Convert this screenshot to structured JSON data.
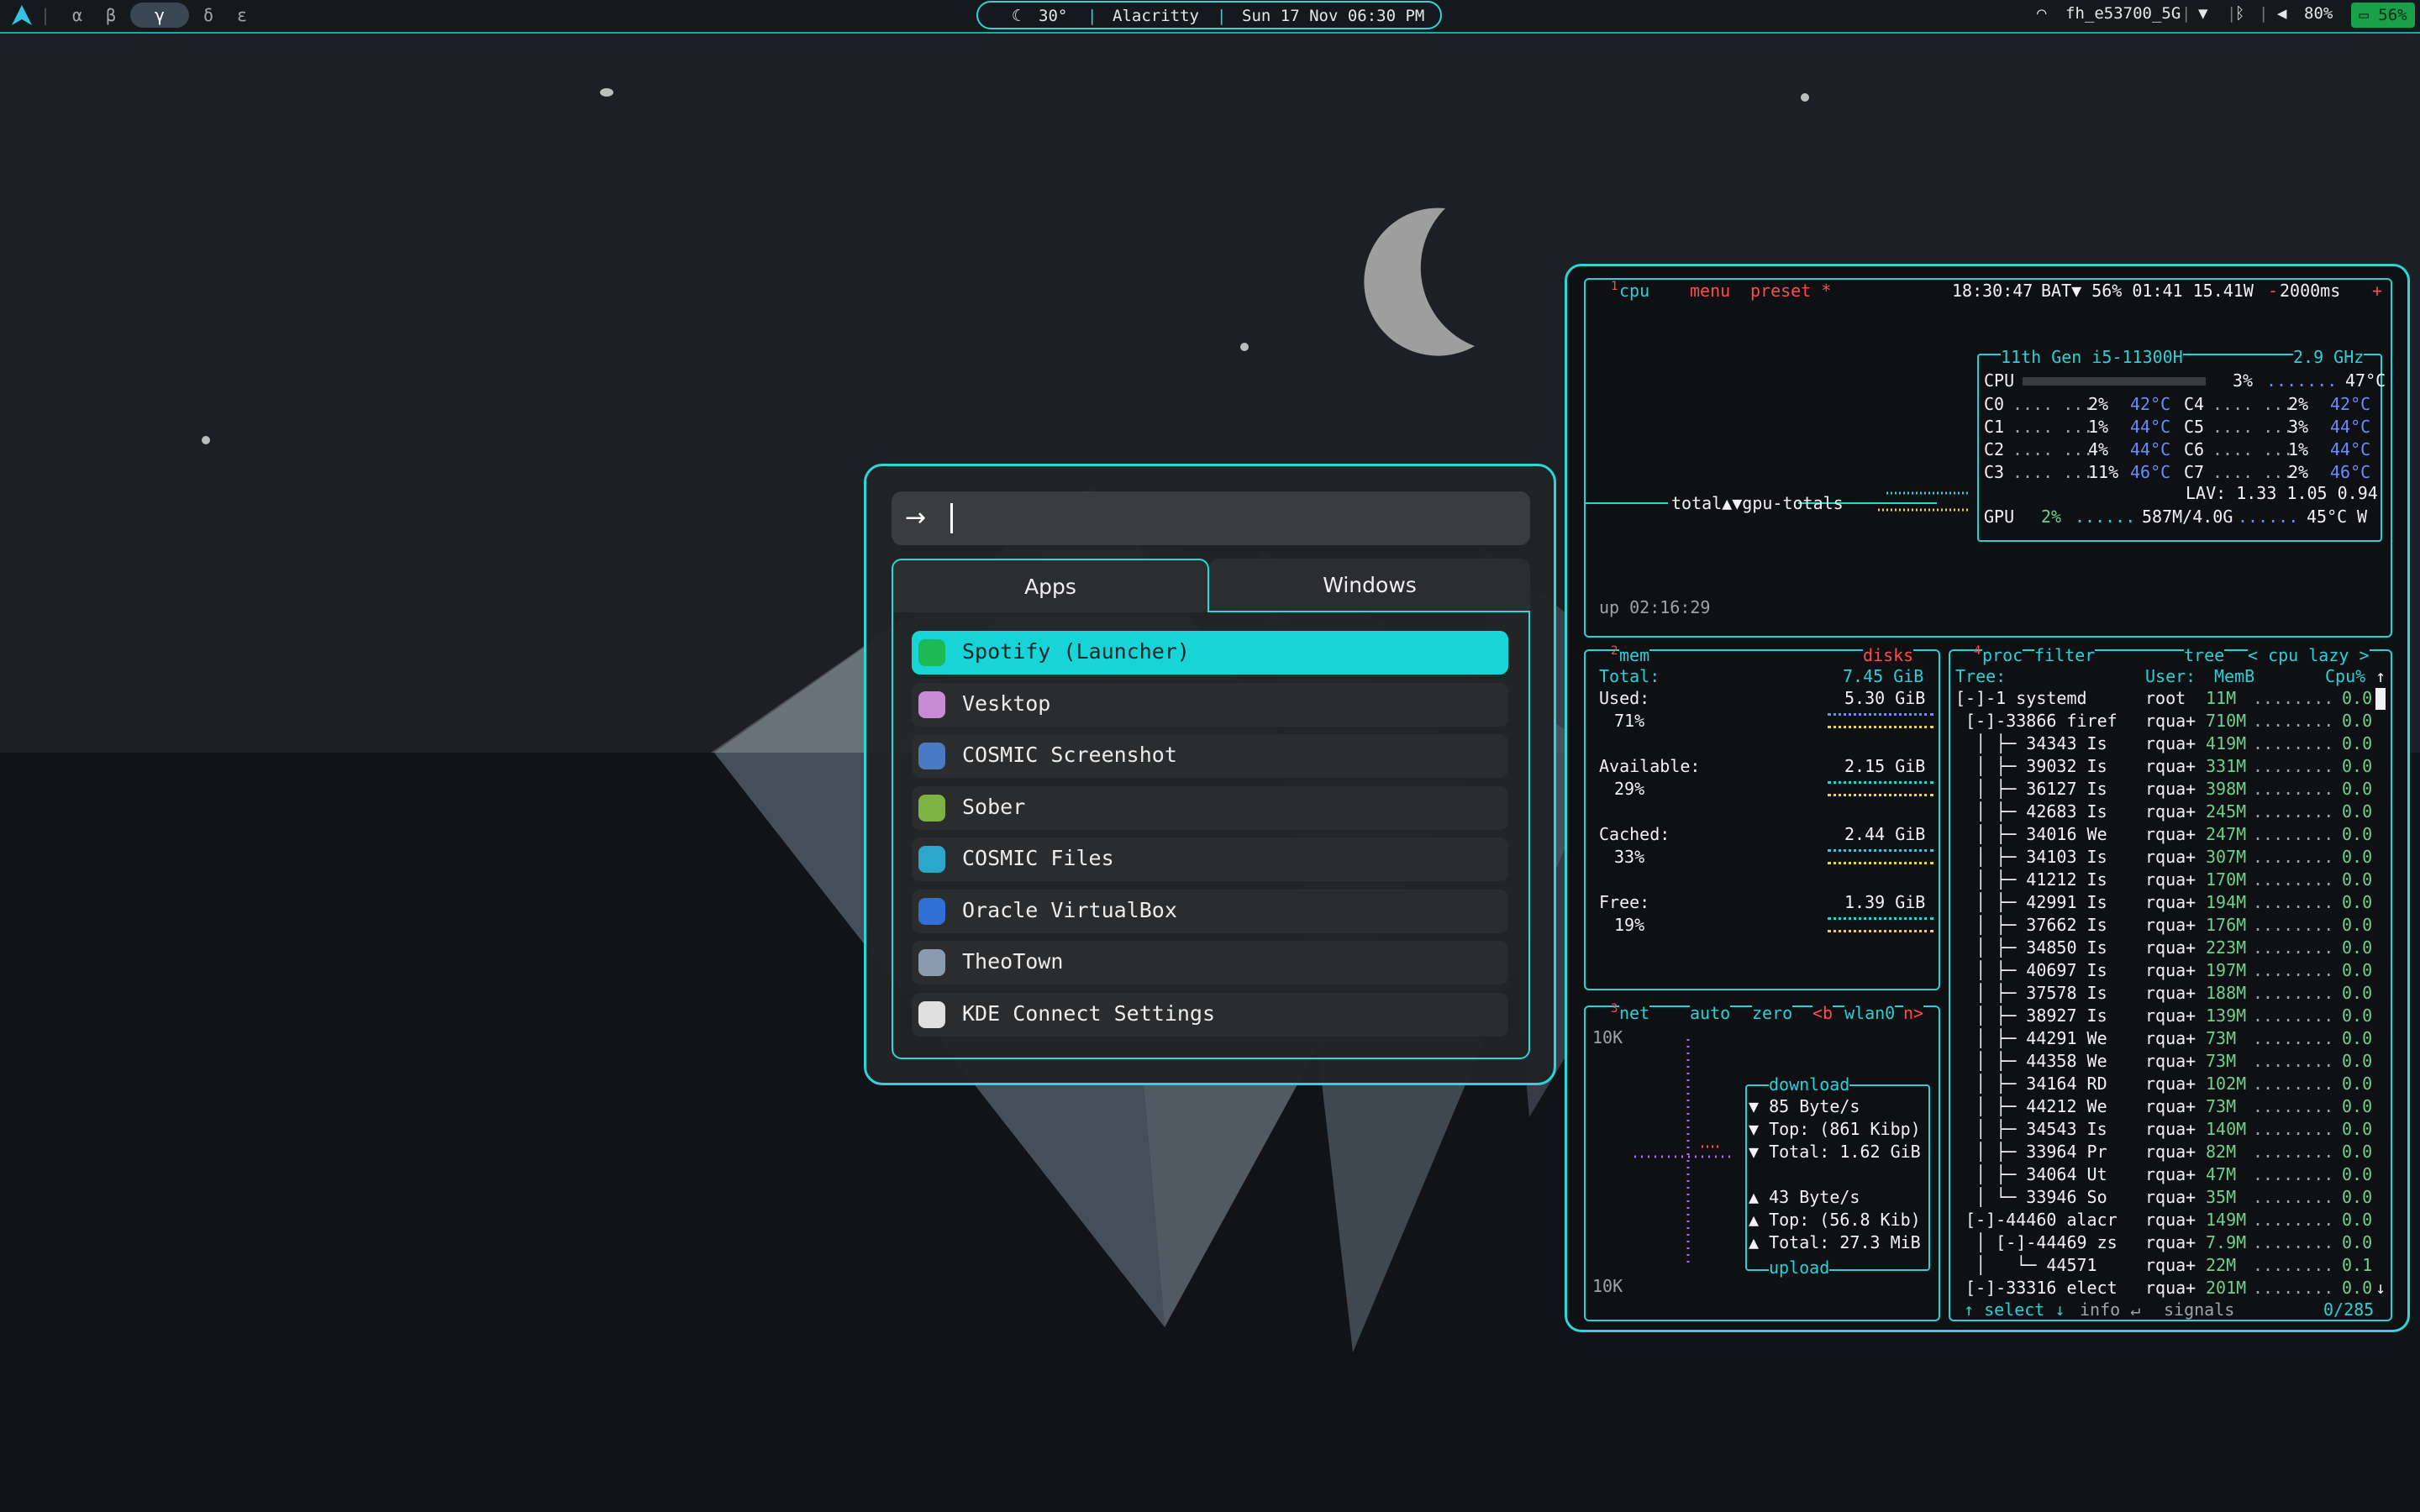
{
  "topbar": {
    "workspaces": [
      "α",
      "β",
      "γ",
      "δ",
      "ε"
    ],
    "active_workspace": "γ",
    "weather": "30°",
    "active_window": "Alacritty",
    "datetime": "Sun 17 Nov 06:30 PM",
    "wifi": "fh_e53700_5G",
    "volume": "80%",
    "battery": "56%"
  },
  "launcher": {
    "prompt_icon": "arrow-right-icon",
    "query": "",
    "tabs": [
      "Apps",
      "Windows"
    ],
    "active_tab": "Apps",
    "items": [
      {
        "label": "Spotify (Launcher)",
        "icon": "spotify-icon",
        "color": "#1db954",
        "selected": true
      },
      {
        "label": "Vesktop",
        "icon": "vesktop-icon",
        "color": "#c98ad6",
        "selected": false
      },
      {
        "label": "COSMIC Screenshot",
        "icon": "screenshot-icon",
        "color": "#4a78c2",
        "selected": false
      },
      {
        "label": "Sober",
        "icon": "sober-icon",
        "color": "#7cb342",
        "selected": false
      },
      {
        "label": "COSMIC Files",
        "icon": "folder-icon",
        "color": "#2aa7c9",
        "selected": false
      },
      {
        "label": "Oracle VirtualBox",
        "icon": "virtualbox-icon",
        "color": "#2f6fd6",
        "selected": false
      },
      {
        "label": "TheoTown",
        "icon": "theotown-icon",
        "color": "#8a9bb0",
        "selected": false
      },
      {
        "label": "KDE Connect Settings",
        "icon": "kdeconnect-icon",
        "color": "#e0e0e0",
        "selected": false
      }
    ]
  },
  "btop": {
    "cpu_header": {
      "num": "1",
      "title": "cpu",
      "menu": "menu",
      "preset": "preset *",
      "clock": "18:30:47",
      "bat": "BAT▼ 56% 01:41 15.41W",
      "interval": "2000ms"
    },
    "cpu_model": "11th Gen i5-11300H",
    "cpu_freq": "2.9 GHz",
    "cpu_total": {
      "label": "CPU",
      "pct": "3%",
      "temp": "47°C"
    },
    "cores": [
      {
        "name": "C0",
        "pct": "2%",
        "temp": "42°C"
      },
      {
        "name": "C1",
        "pct": "1%",
        "temp": "44°C"
      },
      {
        "name": "C2",
        "pct": "4%",
        "temp": "44°C"
      },
      {
        "name": "C3",
        "pct": "11%",
        "temp": "46°C"
      },
      {
        "name": "C4",
        "pct": "2%",
        "temp": "42°C"
      },
      {
        "name": "C5",
        "pct": "3%",
        "temp": "44°C"
      },
      {
        "name": "C6",
        "pct": "1%",
        "temp": "44°C"
      },
      {
        "name": "C7",
        "pct": "2%",
        "temp": "46°C"
      }
    ],
    "lav": "LAV: 1.33 1.05 0.94",
    "gpu": {
      "label": "GPU",
      "pct": "2%",
      "mem": "587M/4.0G",
      "temp": "45°C",
      "suffix": "W"
    },
    "graph_label": "total▲▼gpu-totals",
    "uptime": "up 02:16:29",
    "mem": {
      "num": "2",
      "title": "mem",
      "disks": "disks",
      "total_label": "Total:",
      "total": "7.45 GiB",
      "rows": [
        {
          "label": "Used:",
          "value": "5.30 GiB",
          "pct": "71%"
        },
        {
          "label": "Available:",
          "value": "2.15 GiB",
          "pct": "29%"
        },
        {
          "label": "Cached:",
          "value": "2.44 GiB",
          "pct": "33%"
        },
        {
          "label": "Free:",
          "value": "1.39 GiB",
          "pct": "19%"
        }
      ]
    },
    "net": {
      "num": "3",
      "title": "net",
      "auto": "auto",
      "zero": "zero",
      "b": "<b",
      "iface": "wlan0",
      "n": "n>",
      "scale_top": "10K",
      "scale_bottom": "10K",
      "download_title": "download",
      "download": [
        "▼ 85 Byte/s",
        "▼ Top: (861 Kibp)",
        "▼ Total: 1.62 GiB"
      ],
      "upload": [
        "▲ 43 Byte/s",
        "▲ Top: (56.8 Kib)",
        "▲ Total: 27.3 MiB"
      ],
      "upload_title": "upload"
    },
    "proc": {
      "num": "4",
      "title": "proc",
      "filter": "filter",
      "tree": "tree",
      "sort": "< cpu lazy >",
      "headers": {
        "tree": "Tree:",
        "user": "User:",
        "mem": "MemB",
        "cpu": "Cpu%"
      },
      "rows": [
        {
          "tree": "[-]-1 systemd",
          "user": "root",
          "mem": "11M",
          "cpu": "0.0"
        },
        {
          "tree": " [-]-33866 firef",
          "user": "rqua+",
          "mem": "710M",
          "cpu": "0.0"
        },
        {
          "tree": "  │ ├─ 34343 Is",
          "user": "rqua+",
          "mem": "419M",
          "cpu": "0.0"
        },
        {
          "tree": "  │ ├─ 39032 Is",
          "user": "rqua+",
          "mem": "331M",
          "cpu": "0.0"
        },
        {
          "tree": "  │ ├─ 36127 Is",
          "user": "rqua+",
          "mem": "398M",
          "cpu": "0.0"
        },
        {
          "tree": "  │ ├─ 42683 Is",
          "user": "rqua+",
          "mem": "245M",
          "cpu": "0.0"
        },
        {
          "tree": "  │ ├─ 34016 We",
          "user": "rqua+",
          "mem": "247M",
          "cpu": "0.0"
        },
        {
          "tree": "  │ ├─ 34103 Is",
          "user": "rqua+",
          "mem": "307M",
          "cpu": "0.0"
        },
        {
          "tree": "  │ ├─ 41212 Is",
          "user": "rqua+",
          "mem": "170M",
          "cpu": "0.0"
        },
        {
          "tree": "  │ ├─ 42991 Is",
          "user": "rqua+",
          "mem": "194M",
          "cpu": "0.0"
        },
        {
          "tree": "  │ ├─ 37662 Is",
          "user": "rqua+",
          "mem": "176M",
          "cpu": "0.0"
        },
        {
          "tree": "  │ ├─ 34850 Is",
          "user": "rqua+",
          "mem": "223M",
          "cpu": "0.0"
        },
        {
          "tree": "  │ ├─ 40697 Is",
          "user": "rqua+",
          "mem": "197M",
          "cpu": "0.0"
        },
        {
          "tree": "  │ ├─ 37578 Is",
          "user": "rqua+",
          "mem": "188M",
          "cpu": "0.0"
        },
        {
          "tree": "  │ ├─ 38927 Is",
          "user": "rqua+",
          "mem": "139M",
          "cpu": "0.0"
        },
        {
          "tree": "  │ ├─ 44291 We",
          "user": "rqua+",
          "mem": "73M",
          "cpu": "0.0"
        },
        {
          "tree": "  │ ├─ 44358 We",
          "user": "rqua+",
          "mem": "73M",
          "cpu": "0.0"
        },
        {
          "tree": "  │ ├─ 34164 RD",
          "user": "rqua+",
          "mem": "102M",
          "cpu": "0.0"
        },
        {
          "tree": "  │ ├─ 44212 We",
          "user": "rqua+",
          "mem": "73M",
          "cpu": "0.0"
        },
        {
          "tree": "  │ ├─ 34543 Is",
          "user": "rqua+",
          "mem": "140M",
          "cpu": "0.0"
        },
        {
          "tree": "  │ ├─ 33964 Pr",
          "user": "rqua+",
          "mem": "82M",
          "cpu": "0.0"
        },
        {
          "tree": "  │ ├─ 34064 Ut",
          "user": "rqua+",
          "mem": "47M",
          "cpu": "0.0"
        },
        {
          "tree": "  │ └─ 33946 So",
          "user": "rqua+",
          "mem": "35M",
          "cpu": "0.0"
        },
        {
          "tree": " [-]-44460 alacr",
          "user": "rqua+",
          "mem": "149M",
          "cpu": "0.0"
        },
        {
          "tree": "  │ [-]-44469 zs",
          "user": "rqua+",
          "mem": "7.9M",
          "cpu": "0.0"
        },
        {
          "tree": "  │   └─ 44571",
          "user": "rqua+",
          "mem": "22M",
          "cpu": "0.1"
        },
        {
          "tree": " [-]-33316 elect",
          "user": "rqua+",
          "mem": "201M",
          "cpu": "0.0"
        }
      ],
      "footer": {
        "select": "↑ select ↓",
        "info": "info ↵",
        "signals": "signals",
        "count": "0/285"
      }
    }
  }
}
